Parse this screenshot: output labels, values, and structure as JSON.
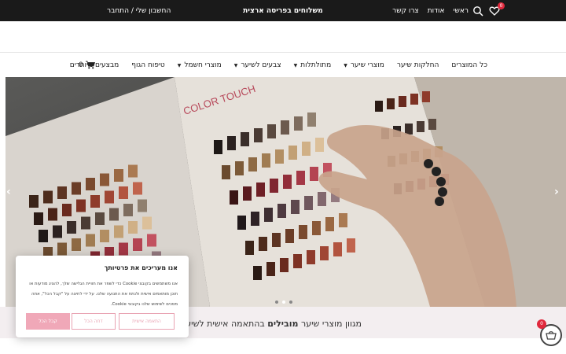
{
  "topbar": {
    "account_link": "החשבון שלי / התחבר",
    "shipping_notice": "משלוחים בפריסה ארצית",
    "links": [
      "ראשי",
      "אודות",
      "צרו קשר"
    ],
    "wishlist_count": "0",
    "icons": [
      "search-icon",
      "heart-icon"
    ],
    "background": "#1a1a1a"
  },
  "nav": {
    "items": [
      {
        "label": "כל המוצרים",
        "dropdown": false
      },
      {
        "label": "החלקות שיער",
        "dropdown": false
      },
      {
        "label": "מוצרי שיער",
        "dropdown": true
      },
      {
        "label": "מתולתלות",
        "dropdown": true
      },
      {
        "label": "צבעים לשיער",
        "dropdown": true
      },
      {
        "label": "מוצרי חשמל",
        "dropdown": true
      },
      {
        "label": "טיפוח הגוף",
        "dropdown": false
      },
      {
        "label": "מבצעים מיוחדים",
        "dropdown": false
      }
    ],
    "cart_count": "0"
  },
  "hero": {
    "swatch_book_label": "COLOR TOUCH",
    "prev_arrow": "‹",
    "next_arrow": "›",
    "slide_count": 3,
    "active_slide": 2
  },
  "strip": {
    "text_prefix": "מגוון מוצרי שיער",
    "text_bold": "מובילים",
    "text_suffix": "בהתאמה אישית לשיערך",
    "background": "#f3eef0"
  },
  "cookie": {
    "title": "אנו מעריכים את פרטיותך",
    "body": "אנו משתמשים בקובצי Cookie כדי לשפר את חוויית הגלישה שלך, להציג מודעות או תוכן מותאמים אישית ולנתח את התנועה שלנו. על ידי לחיצה על \"קבל הכל\", אתה מסכים לשימוש שלנו בקובצי Cookie.",
    "customize_label": "התאמה אישית",
    "reject_label": "דחה הכל",
    "accept_label": "קבל הכל",
    "accent": "#f0a8b8"
  },
  "floating_cart": {
    "count": "0",
    "icon": "basket-icon"
  }
}
